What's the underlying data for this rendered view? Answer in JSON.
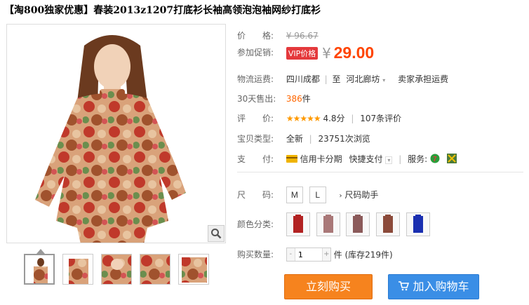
{
  "title": "【淘800独家优惠】春装2013z1207打底衫长袖高领泡泡袖网纱打底衫",
  "price": {
    "label": "价　　格:",
    "old": "¥ 96.67"
  },
  "promo": {
    "label": "参加促销:",
    "badge": "VIP价格",
    "yen": "¥",
    "value": "29.00"
  },
  "shipping": {
    "label": "物流运费:",
    "from": "四川成都",
    "to_prefix": "至",
    "to": "河北廊坊",
    "fee": "卖家承担运费"
  },
  "sales": {
    "label": "30天售出:",
    "count": "386",
    "unit": "件"
  },
  "rating": {
    "label": "评　　价:",
    "stars": "★★★★★",
    "score": "4.8分",
    "reviews": "107条评价"
  },
  "product_type": {
    "label": "宝贝类型:",
    "condition": "全新",
    "views": "23751次浏览"
  },
  "payment": {
    "label": "支　　付:",
    "credit": "信用卡分期",
    "quick": "快捷支付",
    "service_label": "服务:"
  },
  "size": {
    "label": "尺　　码:",
    "options": [
      "M",
      "L"
    ],
    "helper": "尺码助手"
  },
  "color": {
    "label": "颜色分类:",
    "swatches": [
      "#b22222",
      "#a97878",
      "#8b5a5a",
      "#8b4a3a",
      "#1a2fb0"
    ]
  },
  "quantity": {
    "label": "购买数量:",
    "value": "1",
    "stock": "件 (库存219件)"
  },
  "buttons": {
    "buy": "立刻购买",
    "cart": "加入购物车"
  },
  "colors": {
    "accent": "#f40",
    "buy_bg": "#f6831e",
    "cart_bg": "#3a8ee6"
  }
}
